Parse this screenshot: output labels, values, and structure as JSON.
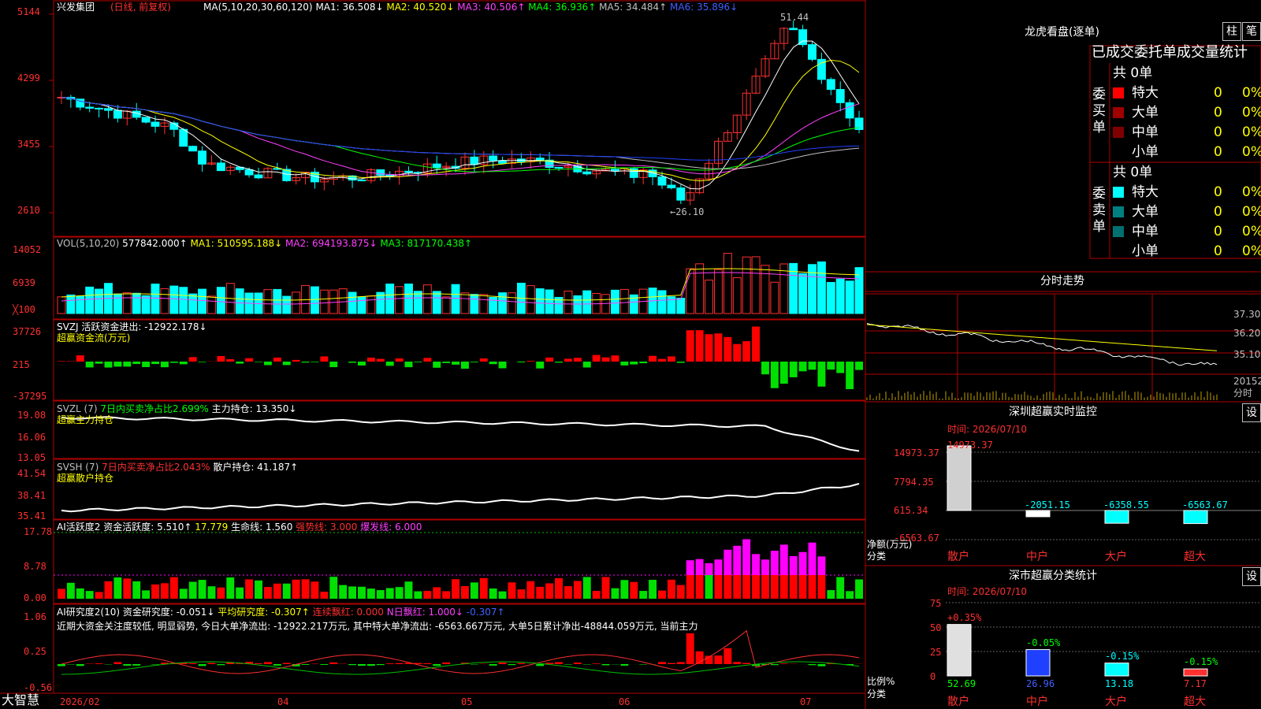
{
  "stock": {
    "name": "兴发集团",
    "mode": "(日线, 前复权)"
  },
  "colors": {
    "up": "#ff3030",
    "down": "#00ffff",
    "ma1": "#ffffff",
    "ma2": "#ffff00",
    "ma3": "#ff40ff",
    "ma4": "#00ff00",
    "ma5": "#c0c0c0",
    "ma6": "#2040ff",
    "grid": "#b00000"
  },
  "main": {
    "ylabels": [
      "5144",
      "4299",
      "3455",
      "2610"
    ],
    "legend": [
      {
        "t": "MA(5,10,20,30,60,120)",
        "c": "w"
      },
      {
        "t": " MA1: 36.508↓",
        "c": "w"
      },
      {
        "t": " MA2: 40.520↓",
        "c": "y"
      },
      {
        "t": " MA3: 40.506↑",
        "c": "m"
      },
      {
        "t": " MA4: 36.936↑",
        "c": "g"
      },
      {
        "t": " MA5: 34.484↑",
        "c": "gray"
      },
      {
        "t": " MA6: 35.896↓",
        "c": "b"
      }
    ],
    "high_label": "51.44",
    "low_label": "←26.10"
  },
  "vol": {
    "ylabels": [
      "14052",
      "6939",
      "╳100"
    ],
    "legend": [
      {
        "t": "VOL(5,10,20)",
        "c": "gray"
      },
      {
        "t": " 577842.000↑",
        "c": "w"
      },
      {
        "t": " MA1: 510595.188↓",
        "c": "y"
      },
      {
        "t": " MA2: 694193.875↓",
        "c": "m"
      },
      {
        "t": " MA3: 817170.438↑",
        "c": "g"
      }
    ]
  },
  "svzj": {
    "ylabels": [
      "37726",
      "215",
      "-37295"
    ],
    "legend": [
      {
        "t": "SVZJ  活跃资金进出: -12922.178↓",
        "c": "w"
      }
    ],
    "sub": "超赢资金流(万元)"
  },
  "svzl": {
    "ylabels": [
      "19.08",
      "16.06",
      "13.05"
    ],
    "legend": [
      {
        "t": "SVZL (7)",
        "c": "gray"
      },
      {
        "t": " 7日内买卖净占比2.699%",
        "c": "g"
      },
      {
        "t": " 主力持仓: 13.350↓",
        "c": "w"
      }
    ],
    "sub": "超赢主力持仓"
  },
  "svsh": {
    "ylabels": [
      "41.54",
      "38.41",
      "35.41"
    ],
    "legend": [
      {
        "t": "SVSH (7)",
        "c": "gray"
      },
      {
        "t": " 7日内买卖净占比2.043%",
        "c": "r"
      },
      {
        "t": " 散户持仓: 41.187↑",
        "c": "w"
      }
    ],
    "sub": "超赢散户持仓"
  },
  "ai1": {
    "ylabels": [
      "17.78",
      "8.78",
      "0.00"
    ],
    "legend": [
      {
        "t": "AI活跃度2",
        "c": "w"
      },
      {
        "t": " 资金活跃度: 5.510↑",
        "c": "w"
      },
      {
        "t": " 17.779",
        "c": "y"
      },
      {
        "t": " 生命线: 1.560",
        "c": "w"
      },
      {
        "t": " 强势线: 3.000",
        "c": "r"
      },
      {
        "t": " 爆发线: 6.000",
        "c": "m"
      }
    ]
  },
  "ai2": {
    "ylabels": [
      "1.06",
      "0.25",
      "-0.56"
    ],
    "legend": [
      {
        "t": "AI研究度2(10)",
        "c": "w"
      },
      {
        "t": " 资金研究度: -0.051↓",
        "c": "w"
      },
      {
        "t": " 平均研究度: -0.307↑",
        "c": "y"
      },
      {
        "t": " 连续飘红: 0.000",
        "c": "r"
      },
      {
        "t": " N日飘红: 1.000↓",
        "c": "m"
      },
      {
        "t": " -0.307↑",
        "c": "b"
      }
    ],
    "text": "近期大资金关注度较低, 明显弱势, 今日大单净流出: -12922.217万元, 其中特大单净流出: -6563.667万元, 大单5日累计净出-48844.059万元, 当前主力"
  },
  "xaxis": {
    "brand": "大智慧",
    "labels": [
      "2026/02",
      "04",
      "05",
      "06",
      "07"
    ]
  },
  "lhb": {
    "title": "龙虎看盘(逐单)",
    "btn1": "柱",
    "btn2": "笔",
    "header": "已成交委托单成交量统计",
    "buy": {
      "label": "委买单",
      "total": "共 0单",
      "rows": [
        {
          "n": "特大",
          "v": "0",
          "p": "0%",
          "c": "#ff0000"
        },
        {
          "n": "大单",
          "v": "0",
          "p": "0%",
          "c": "#a00000"
        },
        {
          "n": "中单",
          "v": "0",
          "p": "0%",
          "c": "#800000"
        },
        {
          "n": "小单",
          "v": "0",
          "p": "0%",
          "c": ""
        }
      ]
    },
    "sell": {
      "label": "委卖单",
      "total": "共 0单",
      "rows": [
        {
          "n": "特大",
          "v": "0",
          "p": "0%",
          "c": "#00ffff"
        },
        {
          "n": "大单",
          "v": "0",
          "p": "0%",
          "c": "#008080"
        },
        {
          "n": "中单",
          "v": "0",
          "p": "0%",
          "c": "#007070"
        },
        {
          "n": "小单",
          "v": "0",
          "p": "0%",
          "c": ""
        }
      ]
    }
  },
  "fenshi": {
    "title": "分时走势",
    "ylabels": [
      "37.30",
      "36.20",
      "35.10",
      "20152",
      "分时"
    ]
  },
  "monitor": {
    "title": "深圳超赢实时监控",
    "btn": "设",
    "time": "时间: 2026/07/10",
    "top": "14973.37",
    "ylabels": [
      "14973.37",
      "7794.35",
      "615.34",
      "-6563.67"
    ],
    "ytitle1": "净额(万元)",
    "ytitle2": "分类",
    "bars": [
      {
        "cat": "散户",
        "val": 14973.37,
        "label": ""
      },
      {
        "cat": "中户",
        "val": -2051.15,
        "label": "-2051.15"
      },
      {
        "cat": "大户",
        "val": -6358.55,
        "label": "-6358.55"
      },
      {
        "cat": "超大",
        "val": -6563.67,
        "label": "-6563.67"
      }
    ]
  },
  "stats": {
    "title": "深市超赢分类统计",
    "btn": "设",
    "time": "时间: 2026/07/10",
    "ylabels": [
      "75",
      "50",
      "25",
      "0"
    ],
    "ytitle1": "比例%",
    "ytitle2": "分类",
    "bars": [
      {
        "cat": "散户",
        "val": 52.69,
        "chg": "+0.35%",
        "chgc": "r",
        "valc": "g",
        "color": "#e0e0e0"
      },
      {
        "cat": "中户",
        "val": 26.96,
        "chg": "-0.05%",
        "chgc": "g",
        "valc": "b",
        "color": "#2040ff"
      },
      {
        "cat": "大户",
        "val": 13.18,
        "chg": "-0.15%",
        "chgc": "c",
        "valc": "c",
        "color": "#00ffff"
      },
      {
        "cat": "超大",
        "val": 7.17,
        "chg": "-0.15%",
        "chgc": "g",
        "valc": "r",
        "color": "#ff3030"
      }
    ]
  }
}
